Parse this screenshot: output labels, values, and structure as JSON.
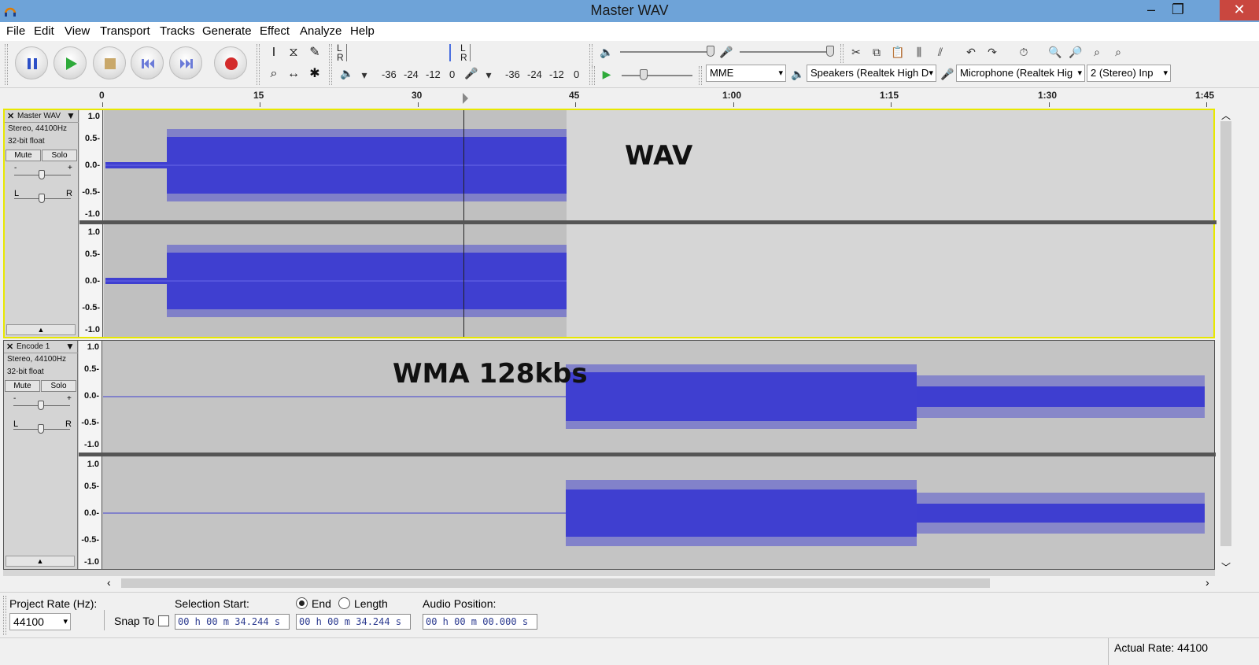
{
  "window": {
    "title": "Master WAV"
  },
  "menu": [
    "File",
    "Edit",
    "View",
    "Transport",
    "Tracks",
    "Generate",
    "Effect",
    "Analyze",
    "Help"
  ],
  "meters": {
    "play_l": "L",
    "play_r": "R",
    "rec_l": "L",
    "rec_r": "R",
    "play_scale": [
      "-36",
      "-24",
      "-12",
      "0"
    ],
    "rec_scale": [
      "-36",
      "-24",
      "-12",
      "0"
    ]
  },
  "devices": {
    "host": "MME",
    "output": "Speakers (Realtek High D",
    "input": "Microphone (Realtek Hig",
    "channels": "2 (Stereo) Inp"
  },
  "timeline": {
    "labels": [
      "0",
      "15",
      "30",
      "45",
      "1:00",
      "1:15",
      "1:30",
      "1:45"
    ]
  },
  "tracks": [
    {
      "name": "Master WAV",
      "info1": "Stereo, 44100Hz",
      "info2": "32-bit float",
      "mute": "Mute",
      "solo": "Solo",
      "gain_minus": "-",
      "gain_plus": "+",
      "pan_l": "L",
      "pan_r": "R",
      "overlay_label": "WAV",
      "scale": [
        "1.0",
        "0.5-",
        "0.0-",
        "-0.5-",
        "-1.0"
      ]
    },
    {
      "name": "Encode 1",
      "info1": "Stereo, 44100Hz",
      "info2": "32-bit float",
      "mute": "Mute",
      "solo": "Solo",
      "gain_minus": "-",
      "gain_plus": "+",
      "pan_l": "L",
      "pan_r": "R",
      "overlay_label": "WMA  128kbs",
      "scale": [
        "1.0",
        "0.5-",
        "0.0-",
        "-0.5-",
        "-1.0"
      ]
    }
  ],
  "selection": {
    "project_rate_label": "Project Rate (Hz):",
    "project_rate": "44100",
    "snap_to_label": "Snap To",
    "selection_start_label": "Selection Start:",
    "end_label": "End",
    "length_label": "Length",
    "audio_position_label": "Audio Position:",
    "selection_start": "00 h 00 m 34.244 s",
    "selection_end": "00 h 00 m 34.244 s",
    "audio_position": "00 h 00 m 00.000 s"
  },
  "status": {
    "actual_rate": "Actual Rate: 44100"
  },
  "colors": {
    "waveform": "#3f3fd0",
    "titlebar": "#6ea3d8",
    "selected_track_border": "#e8e800"
  }
}
